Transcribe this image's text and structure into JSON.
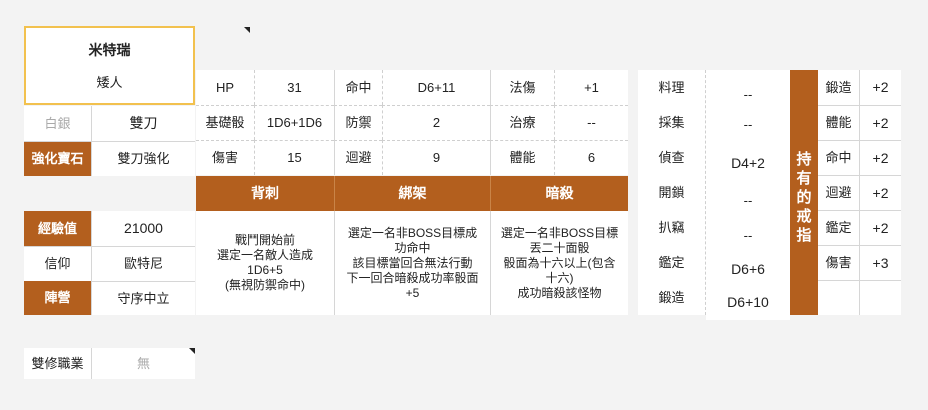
{
  "character": {
    "name": "米特瑞",
    "race": "矮人"
  },
  "left": {
    "rank_label": "白銀",
    "weapon": "雙刀",
    "gem_label": "強化寶石",
    "gem_value": "雙刀強化",
    "exp_label": "經驗值",
    "exp_value": "21000",
    "faith_label": "信仰",
    "faith_value": "歐特尼",
    "camp_label": "陣營",
    "camp_value": "守序中立"
  },
  "stats": [
    [
      "HP",
      "31",
      "命中",
      "D6+11",
      "法傷",
      "+1"
    ],
    [
      "基礎骰",
      "1D6+1D6",
      "防禦",
      "2",
      "治療",
      "--"
    ],
    [
      "傷害",
      "15",
      "迴避",
      "9",
      "體能",
      "6"
    ]
  ],
  "skills": [
    {
      "name": "背刺",
      "desc": "戰鬥開始前\n選定一名敵人造成\n1D6+5\n(無視防禦命中)"
    },
    {
      "name": "綁架",
      "desc": "選定一名非BOSS目標成\n功命中\n該目標當回合無法行動\n下一回合暗殺成功率骰面\n+5"
    },
    {
      "name": "暗殺",
      "desc": "選定一名非BOSS目標\n丟二十面骰\n骰面為十六以上(包含\n十六)\n成功暗殺該怪物"
    }
  ],
  "life_skills": [
    {
      "label": "料理",
      "value": "--"
    },
    {
      "label": "採集",
      "value": "--"
    },
    {
      "label": "偵查",
      "value": "D4+2"
    },
    {
      "label": "開鎖",
      "value": "--"
    },
    {
      "label": "扒竊",
      "value": "--"
    },
    {
      "label": "鑑定",
      "value": "D6+6"
    },
    {
      "label": "鍛造",
      "value": "D6+10"
    }
  ],
  "ring": {
    "title": "持有的戒指",
    "items": [
      {
        "label": "鍛造",
        "value": "+2"
      },
      {
        "label": "體能",
        "value": "+2"
      },
      {
        "label": "命中",
        "value": "+2"
      },
      {
        "label": "迴避",
        "value": "+2"
      },
      {
        "label": "鑑定",
        "value": "+2"
      },
      {
        "label": "傷害",
        "value": "+3"
      },
      {
        "label": "",
        "value": ""
      }
    ]
  },
  "dual_class": {
    "label": "雙修職業",
    "value": "無"
  },
  "colors": {
    "accent": "#b35f1e",
    "name_border": "#f2c14e"
  }
}
